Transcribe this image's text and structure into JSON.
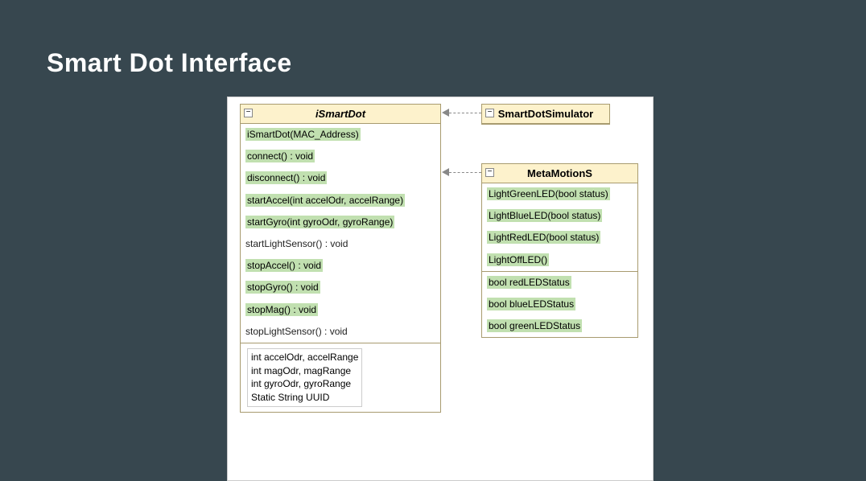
{
  "title": "Smart Dot Interface",
  "ismartDot": {
    "name": "iSmartDot",
    "methods": [
      {
        "text": "iSmartDot(MAC_Address)",
        "hl": true
      },
      {
        "text": "connect() : void",
        "hl": true
      },
      {
        "text": "disconnect() : void",
        "hl": true
      },
      {
        "text": "startAccel(int accelOdr, accelRange)",
        "hl": true
      },
      {
        "text": "startGyro(int gyroOdr, gyroRange)",
        "hl": true
      },
      {
        "text": "startLightSensor() : void",
        "hl": false
      },
      {
        "text": "stopAccel() : void",
        "hl": true
      },
      {
        "text": "stopGyro() : void",
        "hl": true
      },
      {
        "text": "stopMag() : void",
        "hl": true
      },
      {
        "text": "stopLightSensor() : void",
        "hl": false
      }
    ],
    "attributes": [
      "int accelOdr, accelRange",
      "int magOdr, magRange",
      "int gyroOdr, gyroRange",
      "Static String UUID"
    ]
  },
  "simulator": {
    "name": "SmartDotSimulator"
  },
  "metaMotion": {
    "name": "MetaMotionS",
    "methods": [
      {
        "text": "LightGreenLED(bool status)",
        "hl": true
      },
      {
        "text": "LightBlueLED(bool status)",
        "hl": true
      },
      {
        "text": "LightRedLED(bool status)",
        "hl": true
      },
      {
        "text": "LightOffLED()",
        "hl": true
      }
    ],
    "fields": [
      {
        "text": "bool redLEDStatus",
        "hl": true
      },
      {
        "text": "bool blueLEDStatus",
        "hl": true
      },
      {
        "text": "bool greenLEDStatus",
        "hl": true
      }
    ]
  }
}
